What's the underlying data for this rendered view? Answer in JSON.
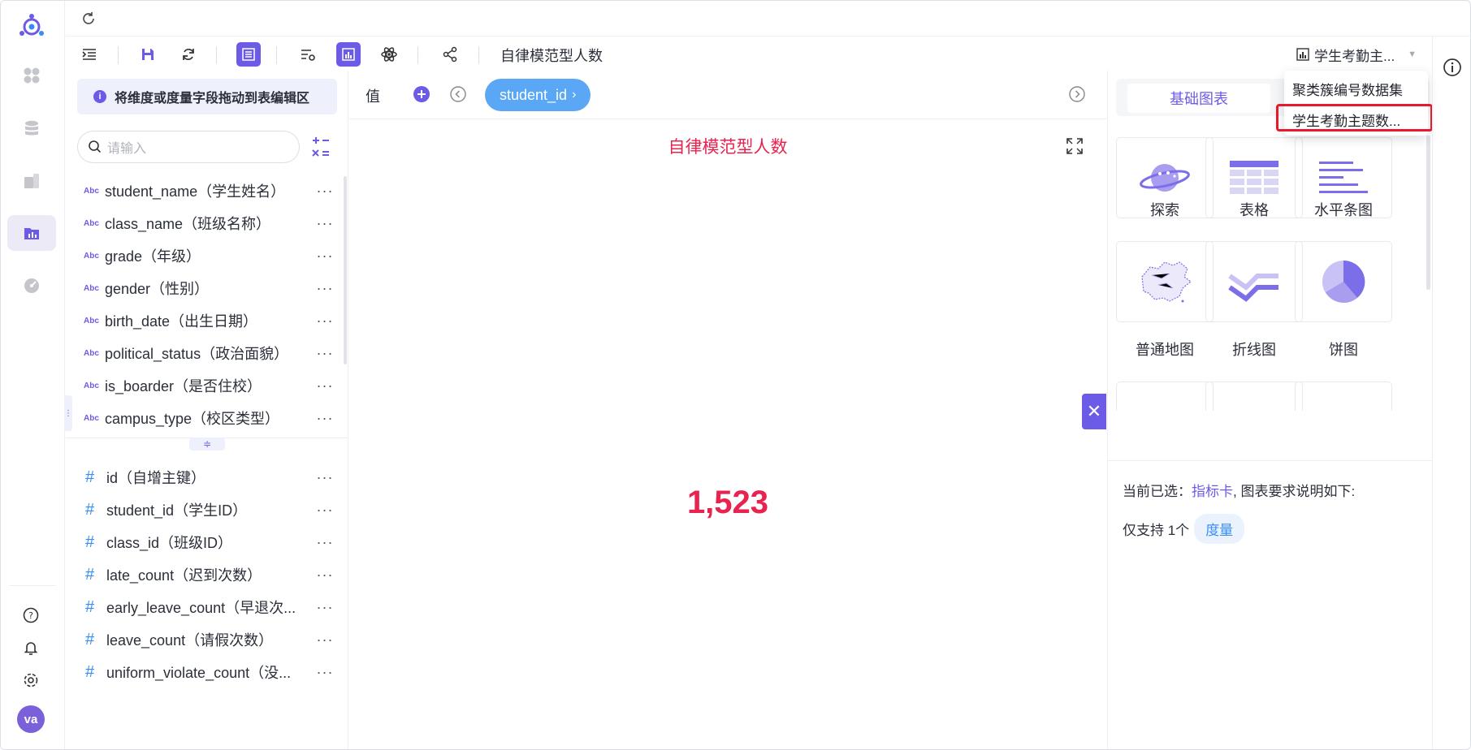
{
  "header": {
    "chart_name": "自律模范型人数",
    "dataset_selected": "学生考勤主..."
  },
  "fields_panel": {
    "hint": "将维度或度量字段拖动到表编辑区",
    "search_placeholder": "请输入",
    "dimension_type_label": "Abc",
    "measure_type_label": "#",
    "dimensions": [
      "student_name（学生姓名）",
      "class_name（班级名称）",
      "grade（年级）",
      "gender（性别）",
      "birth_date（出生日期）",
      "political_status（政治面貌）",
      "is_boarder（是否住校）",
      "campus_type（校区类型）"
    ],
    "measures": [
      "id（自增主键）",
      "student_id（学生ID）",
      "class_id（班级ID）",
      "late_count（迟到次数）",
      "early_leave_count（早退次...",
      "leave_count（请假次数）",
      "uniform_violate_count（没..."
    ]
  },
  "main": {
    "value_label": "值",
    "value_field": "student_id",
    "chart_title": "自律模范型人数",
    "kpi_value": "1,523"
  },
  "chart_panel": {
    "tab_basic": "基础图表",
    "charts": [
      "探索",
      "表格",
      "水平条图",
      "普通地图",
      "折线图",
      "饼图"
    ],
    "desc_prefix": "当前已选：",
    "selected_chart": "指标卡",
    "desc_suffix": ", 图表要求说明如下:",
    "support_text": "仅支持 1个",
    "support_tag": "度量"
  },
  "dropdown": {
    "items": [
      "聚类簇编号数据集",
      "学生考勤主题数..."
    ]
  },
  "user": {
    "initials": "va"
  },
  "colors": {
    "accent": "#6c5be7",
    "kpi": "#e8234f",
    "pill": "#5aa7f5",
    "highlight": "#e8192c"
  }
}
